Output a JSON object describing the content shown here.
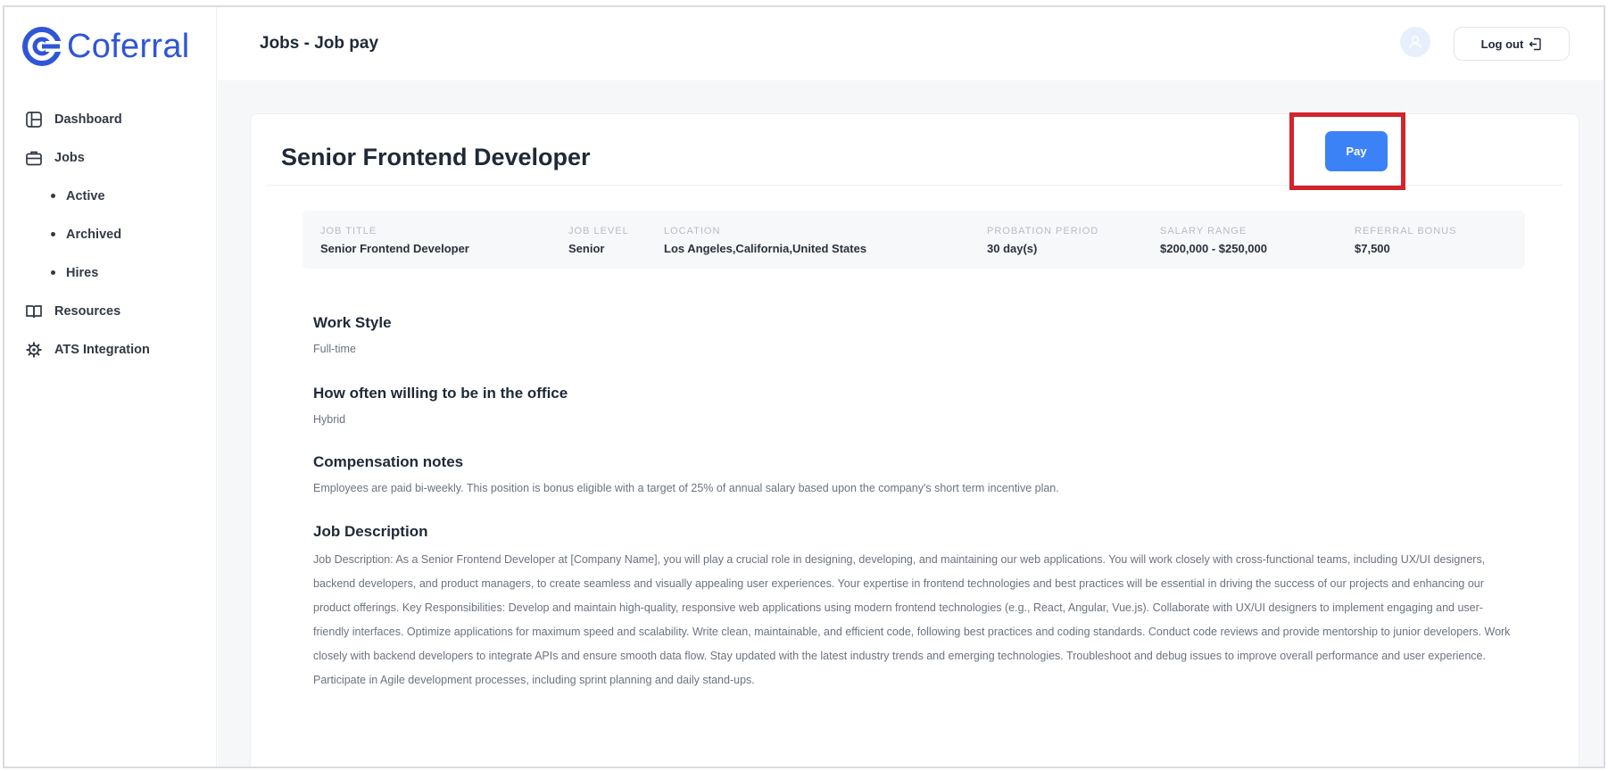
{
  "brand": {
    "name": "Coferral",
    "color": "#2f56d6"
  },
  "sidebar": {
    "items": [
      {
        "label": "Dashboard",
        "icon": "dashboard-icon"
      },
      {
        "label": "Jobs",
        "icon": "briefcase-icon"
      },
      {
        "label": "Active"
      },
      {
        "label": "Archived"
      },
      {
        "label": "Hires"
      },
      {
        "label": "Resources",
        "icon": "book-icon"
      },
      {
        "label": "ATS Integration",
        "icon": "gear-icon"
      }
    ]
  },
  "header": {
    "title": "Jobs - Job pay",
    "logout_label": "Log out",
    "avatar_icon": "user-icon"
  },
  "job": {
    "title": "Senior Frontend Developer",
    "pay_label": "Pay",
    "accent": "#3b82f6",
    "highlight_color": "#d1242b",
    "summary": [
      {
        "label": "JOB TITLE",
        "value": "Senior Frontend Developer"
      },
      {
        "label": "JOB LEVEL",
        "value": "Senior"
      },
      {
        "label": "LOCATION",
        "value": "Los Angeles,California,United States"
      },
      {
        "label": "PROBATION PERIOD",
        "value": "30 day(s)"
      },
      {
        "label": "SALARY RANGE",
        "value": "$200,000 - $250,000"
      },
      {
        "label": "REFERRAL BONUS",
        "value": "$7,500"
      }
    ],
    "sections": [
      {
        "heading": "Work Style",
        "body": "Full-time"
      },
      {
        "heading": "How often willing to be in the office",
        "body": "Hybrid"
      },
      {
        "heading": "Compensation notes",
        "body": "Employees are paid bi-weekly. This position is bonus eligible with a target of 25% of annual salary based upon the company's short term incentive plan."
      },
      {
        "heading": "Job Description",
        "body": "Job Description: As a Senior Frontend Developer at [Company Name], you will play a crucial role in designing, developing, and maintaining our web applications. You will work closely with cross-functional teams, including UX/UI designers, backend developers, and product managers, to create seamless and visually appealing user experiences. Your expertise in frontend technologies and best practices will be essential in driving the success of our projects and enhancing our product offerings. Key Responsibilities: Develop and maintain high-quality, responsive web applications using modern frontend technologies (e.g., React, Angular, Vue.js). Collaborate with UX/UI designers to implement engaging and user-friendly interfaces. Optimize applications for maximum speed and scalability. Write clean, maintainable, and efficient code, following best practices and coding standards. Conduct code reviews and provide mentorship to junior developers. Work closely with backend developers to integrate APIs and ensure smooth data flow. Stay updated with the latest industry trends and emerging technologies. Troubleshoot and debug issues to improve overall performance and user experience. Participate in Agile development processes, including sprint planning and daily stand-ups."
      }
    ]
  }
}
